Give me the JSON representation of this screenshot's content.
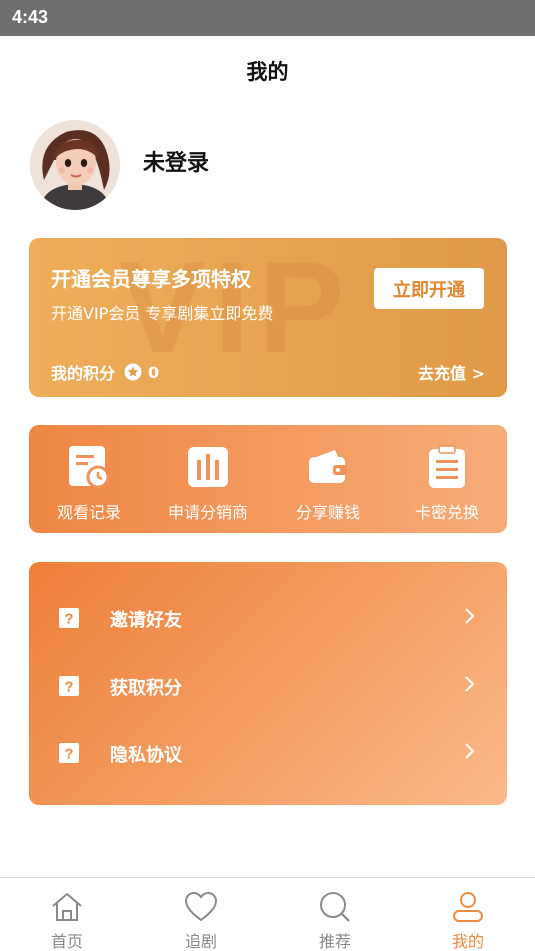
{
  "status_bar": {
    "time": "4:43"
  },
  "header": {
    "title": "我的"
  },
  "profile": {
    "name": "未登录"
  },
  "vip": {
    "title": "开通会员尊享多项特权",
    "subtitle": "开通VIP会员 专享剧集立即免费",
    "button_label": "立即开通",
    "points_label": "我的积分",
    "points_value": "0",
    "recharge_label": "去充值 >",
    "watermark": "VIP"
  },
  "actions": [
    {
      "label": "观看记录",
      "icon": "history-icon"
    },
    {
      "label": "申请分销商",
      "icon": "chart-bars-icon"
    },
    {
      "label": "分享赚钱",
      "icon": "wallet-icon"
    },
    {
      "label": "卡密兑换",
      "icon": "clipboard-icon"
    }
  ],
  "menu": [
    {
      "label": "邀请好友"
    },
    {
      "label": "获取积分"
    },
    {
      "label": "隐私协议"
    }
  ],
  "tabbar": [
    {
      "label": "首页",
      "icon": "home-icon"
    },
    {
      "label": "追剧",
      "icon": "heart-icon"
    },
    {
      "label": "推荐",
      "icon": "search-icon"
    },
    {
      "label": "我的",
      "icon": "user-icon",
      "active": true
    }
  ],
  "colors": {
    "accent": "#ef8a3e",
    "vip_gold": "#e7a34f",
    "status_bar": "#6f6f6f"
  }
}
